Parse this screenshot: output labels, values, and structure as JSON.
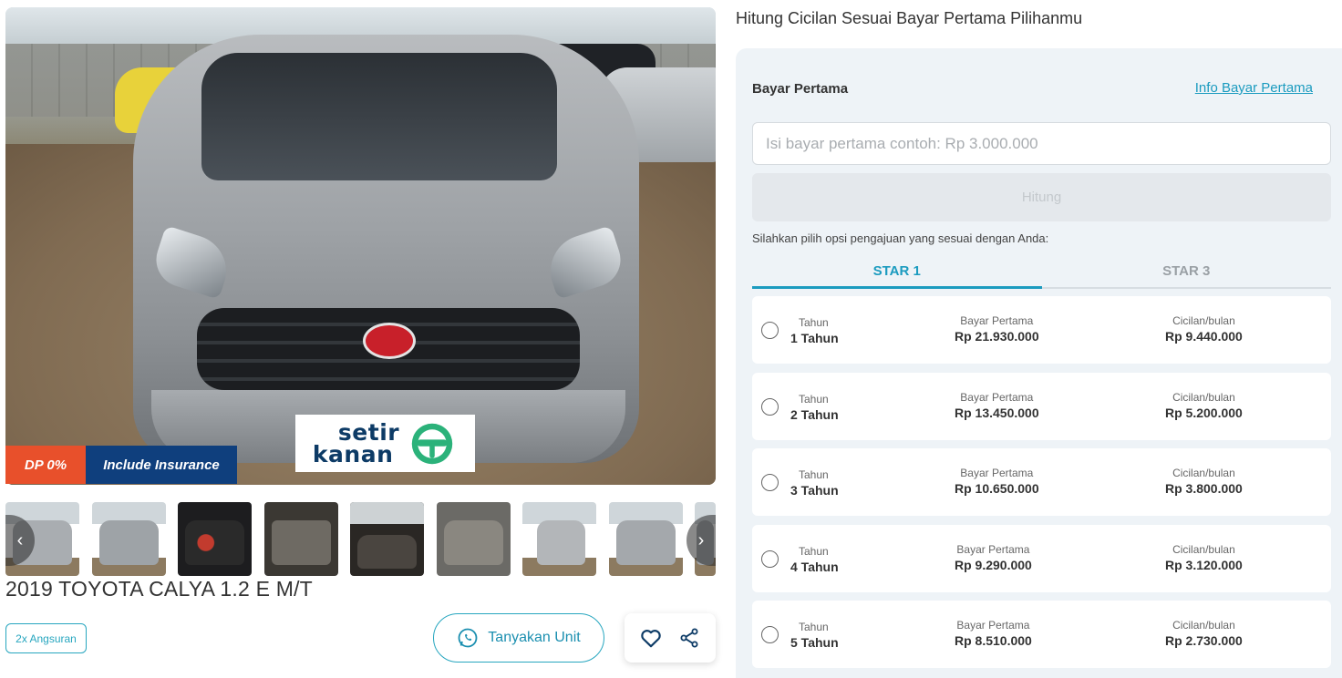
{
  "gallery": {
    "watermark": {
      "line1": "setir",
      "line2": "kanan"
    },
    "badges": {
      "dp": "DP 0%",
      "insurance": "Include Insurance"
    },
    "thumbnails": [
      {
        "label": "front-left"
      },
      {
        "label": "rear-left"
      },
      {
        "label": "dashboard-gauges"
      },
      {
        "label": "trunk"
      },
      {
        "label": "interior"
      },
      {
        "label": "engine"
      },
      {
        "label": "front-three-quarter"
      },
      {
        "label": "rear"
      },
      {
        "label": "partial"
      }
    ],
    "nav": {
      "prev": "‹",
      "next": "›"
    }
  },
  "listing": {
    "title": "2019 TOYOTA CALYA 1.2 E M/T",
    "chip": "2x Angsuran",
    "ask_button": "Tanyakan Unit"
  },
  "calculator": {
    "heading": "Hitung Cicilan Sesuai Bayar Pertama Pilihanmu",
    "bayar_label": "Bayar Pertama",
    "info_link": "Info Bayar Pertama",
    "input_placeholder": "Isi bayar pertama contoh: Rp 3.000.000",
    "input_value": "",
    "hitung_button": "Hitung",
    "helper_text": "Silahkan pilih opsi pengajuan yang sesuai dengan Anda:",
    "tabs": [
      {
        "label": "STAR 1",
        "active": true
      },
      {
        "label": "STAR 3",
        "active": false
      }
    ],
    "col_labels": {
      "tenor": "Tahun",
      "bayar": "Bayar Pertama",
      "cicilan": "Cicilan/bulan"
    },
    "options": [
      {
        "tenor": "1 Tahun",
        "bayar": "Rp 21.930.000",
        "cicilan": "Rp 9.440.000"
      },
      {
        "tenor": "2 Tahun",
        "bayar": "Rp 13.450.000",
        "cicilan": "Rp 5.200.000"
      },
      {
        "tenor": "3 Tahun",
        "bayar": "Rp 10.650.000",
        "cicilan": "Rp 3.800.000"
      },
      {
        "tenor": "4 Tahun",
        "bayar": "Rp 9.290.000",
        "cicilan": "Rp 3.120.000"
      },
      {
        "tenor": "5 Tahun",
        "bayar": "Rp 8.510.000",
        "cicilan": "Rp 2.730.000"
      }
    ]
  },
  "colors": {
    "accent": "#1b9bbf",
    "dp_badge": "#e8502b",
    "insurance_badge": "#0f3f7d",
    "panel_bg": "#eef3f7"
  },
  "icons": {
    "whatsapp": "whatsapp-icon",
    "favorite": "heart-icon",
    "share": "share-icon",
    "steering": "steering-wheel-icon"
  }
}
